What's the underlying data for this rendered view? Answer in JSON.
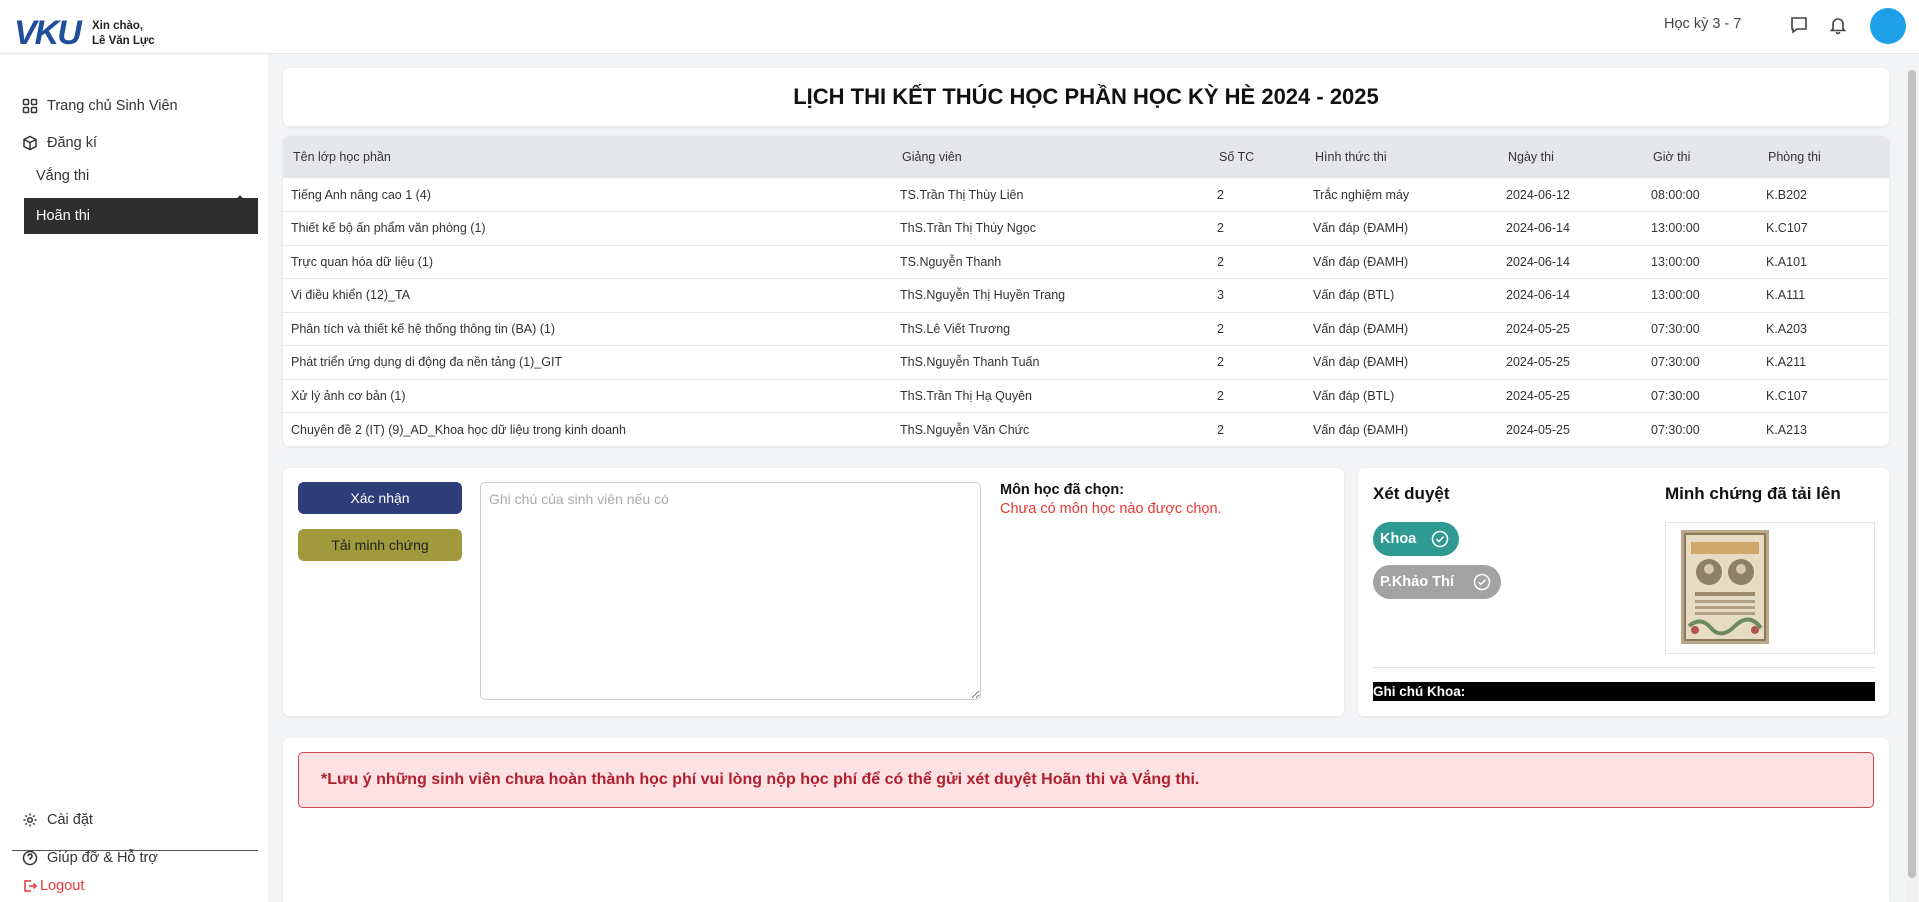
{
  "header": {
    "logo_text": "VKU",
    "greeting_line1": "Xin chào,",
    "greeting_line2": "Lê Văn Lực",
    "semester": "Học kỳ 3 - 7",
    "icons": [
      "message-icon",
      "bell-icon",
      "avatar"
    ],
    "avatar_color": "#1ea0e8"
  },
  "sidebar": {
    "items": [
      {
        "label": "Trang chủ Sinh Viên",
        "icon": "grid-icon"
      },
      {
        "label": "Đăng kí",
        "icon": "cube-icon",
        "expanded": true
      }
    ],
    "sub_items": [
      {
        "label": "Vắng thi",
        "active": false
      },
      {
        "label": "Hoãn thi",
        "active": true
      }
    ],
    "bottom": [
      {
        "label": "Cài đặt",
        "icon": "gear-icon"
      },
      {
        "label": "Giúp đỡ & Hỗ trợ",
        "icon": "help-icon"
      }
    ],
    "logout": "Logout"
  },
  "main": {
    "title": "LỊCH THI KẾT THÚC HỌC PHẦN HỌC KỲ HÈ 2024 - 2025",
    "table": {
      "columns": [
        "Tên lớp học phần",
        "Giảng viên",
        "Số TC",
        "Hình thức thi",
        "Ngày thi",
        "Giờ thi",
        "Phòng thi"
      ],
      "rows": [
        [
          "Tiếng Anh nâng cao 1 (4)",
          "TS.Trần Thị Thùy Liên",
          "2",
          "Trắc nghiệm máy",
          "2024-06-12",
          "08:00:00",
          "K.B202"
        ],
        [
          "Thiết kế bộ ấn phẩm văn phòng (1)",
          "ThS.Trần Thị Thúy Ngọc",
          "2",
          "Vấn đáp (ĐAMH)",
          "2024-06-14",
          "13:00:00",
          "K.C107"
        ],
        [
          "Trực quan hóa dữ liệu (1)",
          "TS.Nguyễn Thanh",
          "2",
          "Vấn đáp (ĐAMH)",
          "2024-06-14",
          "13:00:00",
          "K.A101"
        ],
        [
          "Vi điều khiển (12)_TA",
          "ThS.Nguyễn Thị Huyền Trang",
          "3",
          "Vấn đáp (BTL)",
          "2024-06-14",
          "13:00:00",
          "K.A111"
        ],
        [
          "Phân tích và thiết kế hệ thống thông tin (BA) (1)",
          "ThS.Lê Viết Trương",
          "2",
          "Vấn đáp (ĐAMH)",
          "2024-05-25",
          "07:30:00",
          "K.A203"
        ],
        [
          "Phát triển ứng dụng di động đa nền tảng (1)_GIT",
          "ThS.Nguyễn Thanh Tuấn",
          "2",
          "Vấn đáp (ĐAMH)",
          "2024-05-25",
          "07:30:00",
          "K.A211"
        ],
        [
          "Xử lý ảnh cơ bản (1)",
          "ThS.Trần Thị Hạ Quyên",
          "2",
          "Vấn đáp (BTL)",
          "2024-05-25",
          "07:30:00",
          "K.C107"
        ],
        [
          "Chuyên đề 2 (IT) (9)_AD_Khoa học dữ liệu trong kinh doanh",
          "ThS.Nguyễn Văn Chức",
          "2",
          "Vấn đáp (ĐAMH)",
          "2024-05-25",
          "07:30:00",
          "K.A213"
        ]
      ]
    },
    "form": {
      "confirm_button": "Xác nhận",
      "upload_button": "Tải minh chứng",
      "note_placeholder": "Ghi chú của sinh viên nếu có",
      "note_value": "",
      "chosen_label": "Môn học đã chọn:",
      "chosen_empty": "Chưa có môn học nào được chọn."
    },
    "review": {
      "title": "Xét duyệt",
      "evidence_title": "Minh chứng đã tải lên",
      "stages": [
        {
          "label": "Khoa",
          "color": "#2f9a92"
        },
        {
          "label": "P.Khảo Thí",
          "color": "#a3a3a3"
        }
      ],
      "faculty_note": "Ghi chú Khoa:"
    },
    "notice": "*Lưu ý những sinh viên chưa hoàn thành học phí vui lòng nộp học phí để có thể gửi xét duyệt Hoãn thi và Vắng thi."
  }
}
